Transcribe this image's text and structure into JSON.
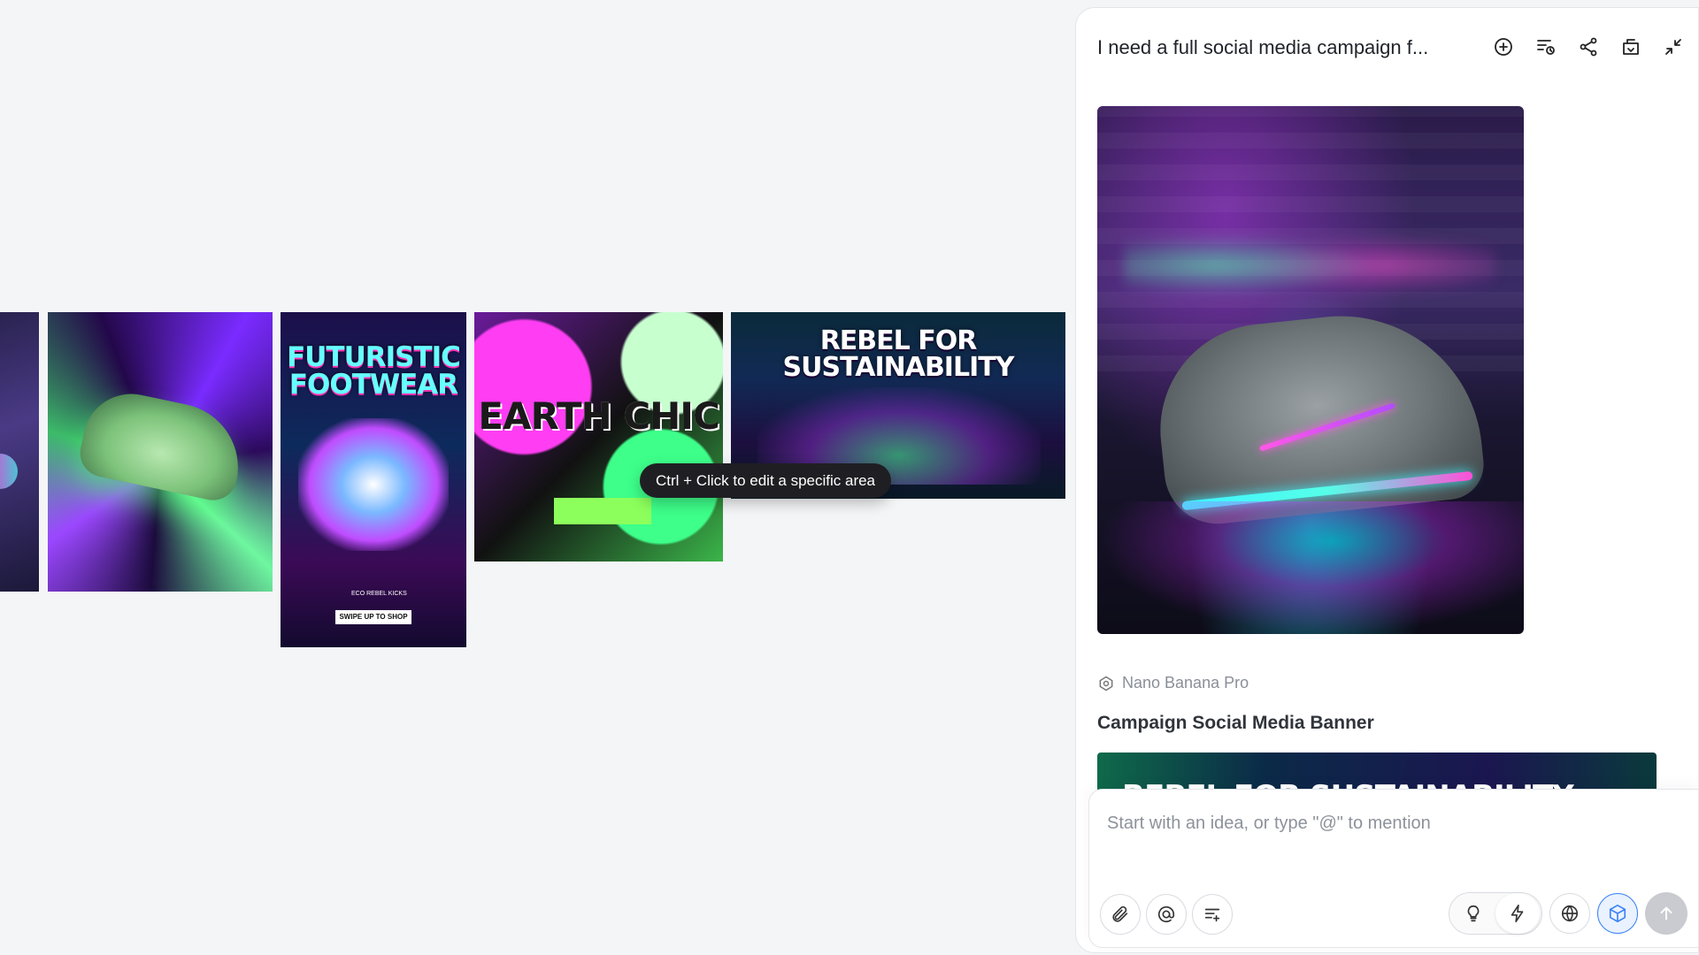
{
  "canvas": {
    "thumbnails": [
      {
        "name": "partial-graffiti-image",
        "caption": ""
      },
      {
        "name": "neon-green-shoe",
        "caption": ""
      },
      {
        "name": "futuristic-footwear-story",
        "caption": "FUTURISTIC FOOTWEAR",
        "cta": "SWIPE UP TO SHOP",
        "brand": "ECO REBEL KICKS"
      },
      {
        "name": "earth-chic-poster",
        "caption": "EARTH CHIC"
      },
      {
        "name": "rebel-banner",
        "caption": "REBEL FOR SUSTAINABILITY"
      }
    ],
    "tooltip": "Ctrl + Click to edit a specific area"
  },
  "panel": {
    "title": "I need a full social media campaign f...",
    "header_icons": [
      "new-chat-icon",
      "history-icon",
      "share-icon",
      "export-icon",
      "collapse-icon"
    ],
    "model_name": "Nano Banana Pro",
    "section_title": "Campaign Social Media Banner",
    "banner_preview_text": "REBEL FOR SUSTAINABILITY"
  },
  "composer": {
    "placeholder": "Start with an idea, or type \"@\" to mention",
    "value": "",
    "left_tools": [
      "attach-icon",
      "mention-icon",
      "prompt-template-icon"
    ],
    "right_tools": [
      "idea-icon",
      "lightning-icon",
      "globe-icon",
      "cube-icon"
    ],
    "send_icon": "arrow-up-icon"
  },
  "colors": {
    "background": "#f4f5f7",
    "panel": "#ffffff",
    "accent": "#3b82f6",
    "send_disabled": "#c9cbd0"
  }
}
